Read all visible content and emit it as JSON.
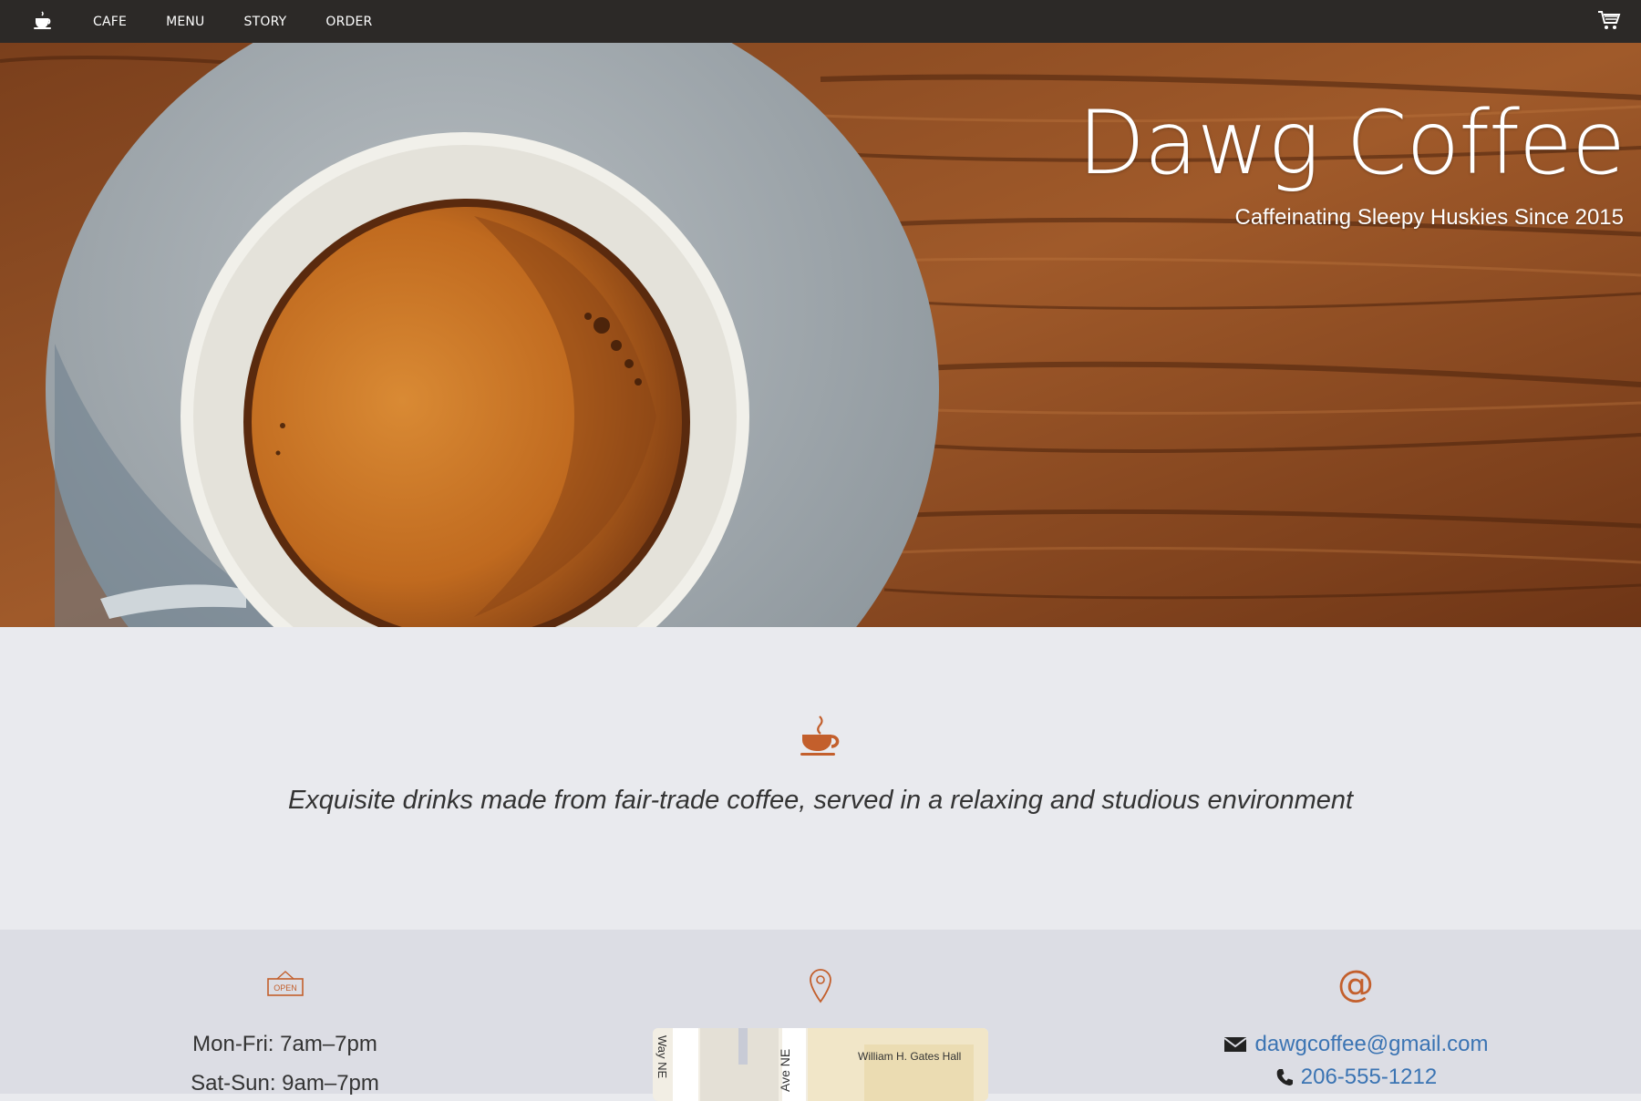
{
  "nav": {
    "brand_icon": "coffee-cup-icon",
    "links": [
      "CAFE",
      "MENU",
      "STORY",
      "ORDER"
    ],
    "cart_icon": "shopping-cart-icon"
  },
  "hero": {
    "title": "Dawg Coffee",
    "subtitle": "Caffeinating Sleepy Huskies Since 2015"
  },
  "intro": {
    "icon": "coffee-cup-icon",
    "tagline": "Exquisite drinks made from fair-trade coffee, served in a relaxing and studious environment"
  },
  "info": {
    "hours": {
      "icon": "open-sign-icon",
      "sign_text": "OPEN",
      "lines": [
        "Mon-Fri: 7am–7pm",
        "Sat-Sun: 9am–7pm"
      ]
    },
    "location": {
      "icon": "map-pin-icon",
      "map_labels": [
        "Way NE",
        "Ave NE",
        "William H. Gates Hall"
      ]
    },
    "contact": {
      "icon": "at-icon",
      "email": "dawgcoffee@gmail.com",
      "phone": "206-555-1212"
    }
  },
  "colors": {
    "accent": "#c35f2c",
    "nav_bg": "#2c2927",
    "link": "#3b74b3"
  }
}
